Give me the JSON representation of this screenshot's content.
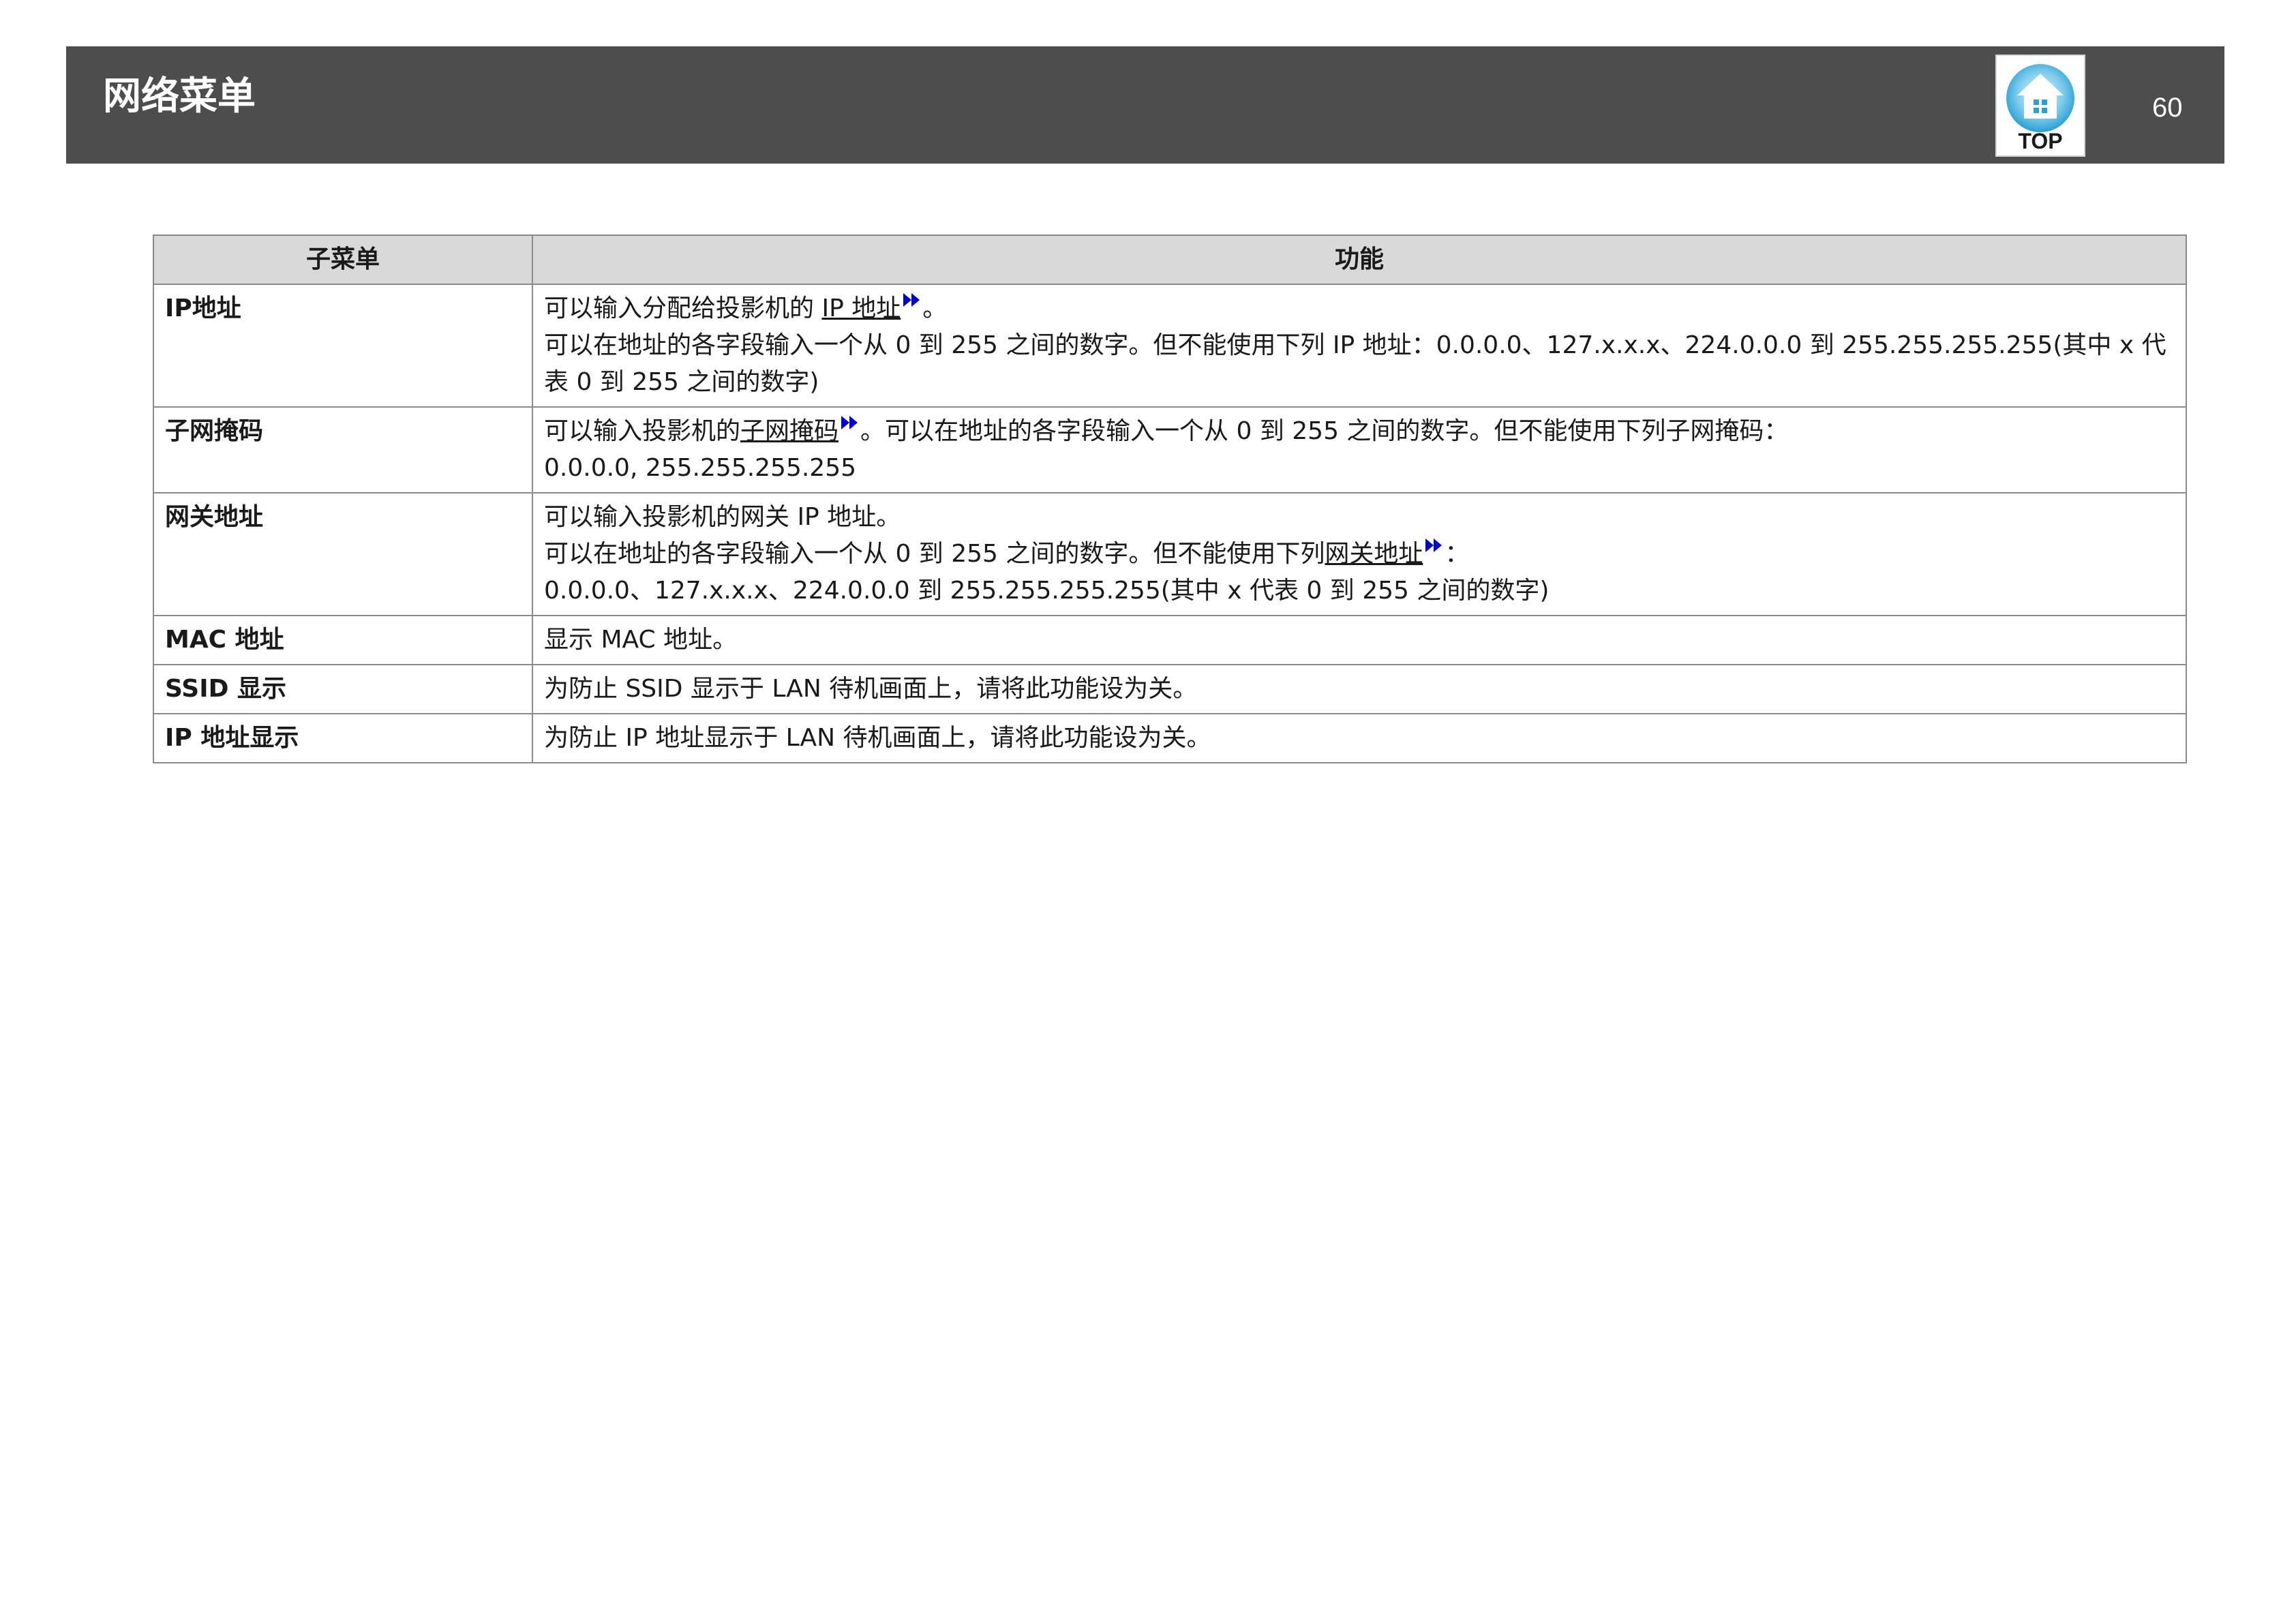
{
  "header": {
    "title": "网络菜单",
    "page_number": "60",
    "top_button_label": "TOP",
    "top_button_icon": "house-icon"
  },
  "table": {
    "headers": [
      "子菜单",
      "功能"
    ],
    "rows": [
      {
        "submenu": "IP地址",
        "lines": [
          {
            "pre": "可以输入分配给投影机的 ",
            "link": "IP 地址",
            "post": "。"
          },
          {
            "text": "可以在地址的各字段输入一个从 0 到 255 之间的数字。但不能使用下列 IP 地址：0.0.0.0、127.x.x.x、224.0.0.0 到 255.255.255.255(其中 x 代表 0 到 255 之间的数字)"
          }
        ]
      },
      {
        "submenu": "子网掩码",
        "lines": [
          {
            "pre": "可以输入投影机的",
            "link": "子网掩码",
            "post": "。可以在地址的各字段输入一个从 0 到 255 之间的数字。但不能使用下列子网掩码："
          },
          {
            "text": "0.0.0.0, 255.255.255.255"
          }
        ]
      },
      {
        "submenu": "网关地址",
        "lines": [
          {
            "text": "可以输入投影机的网关 IP 地址。"
          },
          {
            "pre": "可以在地址的各字段输入一个从 0 到 255 之间的数字。但不能使用下列",
            "link": "网关地址",
            "post": "："
          },
          {
            "text": "0.0.0.0、127.x.x.x、224.0.0.0 到 255.255.255.255(其中 x 代表 0 到 255 之间的数字)"
          }
        ]
      },
      {
        "submenu": "MAC 地址",
        "lines": [
          {
            "text": "显示 MAC 地址。"
          }
        ]
      },
      {
        "submenu": "SSID 显示",
        "lines": [
          {
            "text": "为防止 SSID 显示于 LAN 待机画面上，请将此功能设为关。"
          }
        ]
      },
      {
        "submenu": "IP 地址显示",
        "lines": [
          {
            "text": "为防止 IP 地址显示于 LAN 待机画面上，请将此功能设为关。"
          }
        ]
      }
    ]
  },
  "colors": {
    "header_bg": "#4d4d4d",
    "table_header_bg": "#d9d9d9",
    "link_arrow": "#0000cc"
  }
}
